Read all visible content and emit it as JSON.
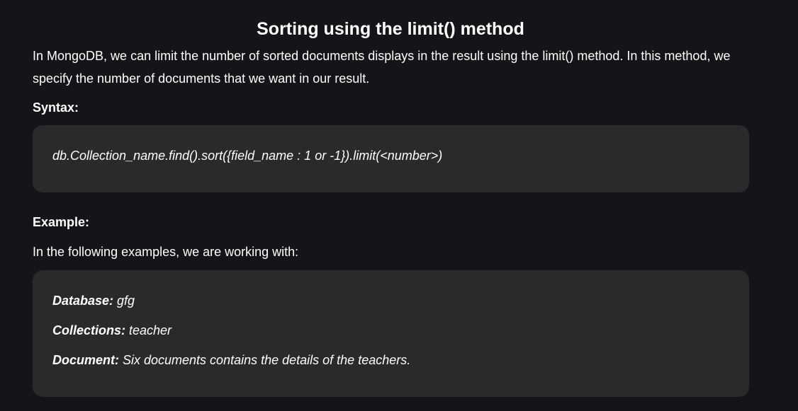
{
  "article": {
    "title": "Sorting using the limit() method",
    "intro": "In MongoDB, we can limit the number of sorted documents displays in the result using the limit() method. In this method, we specify the number of documents that we want in our result.",
    "syntax_label": "Syntax:",
    "syntax_code": "db.Collection_name.find().sort({field_name : 1 or -1}).limit(<number>)",
    "example_label": "Example:",
    "example_intro": "In the following examples, we are working with:",
    "details": [
      {
        "key": "Database:",
        "value": " gfg"
      },
      {
        "key": "Collections:",
        "value": " teacher"
      },
      {
        "key": "Document:",
        "value": " Six documents contains the details of the teachers."
      }
    ]
  }
}
